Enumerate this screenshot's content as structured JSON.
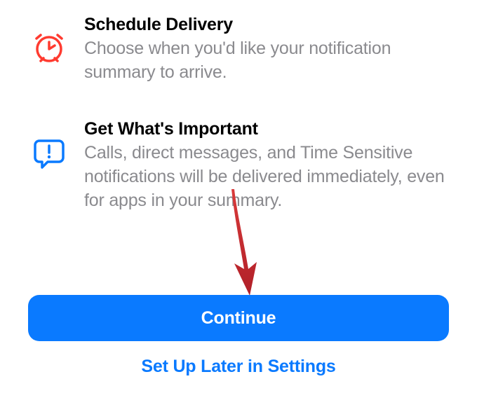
{
  "features": [
    {
      "title": "Schedule Delivery",
      "description": "Choose when you'd like your notification summary to arrive."
    },
    {
      "title": "Get What's Important",
      "description": "Calls, direct messages, and Time Sensitive notifications will be delivered immediately, even for apps in your summary."
    }
  ],
  "buttons": {
    "primary": "Continue",
    "secondary": "Set Up Later in Settings"
  },
  "colors": {
    "accent_blue": "#0a7aff",
    "icon_red": "#ff3b30",
    "text_secondary": "#8a8a8e",
    "arrow": "#c1272d"
  }
}
